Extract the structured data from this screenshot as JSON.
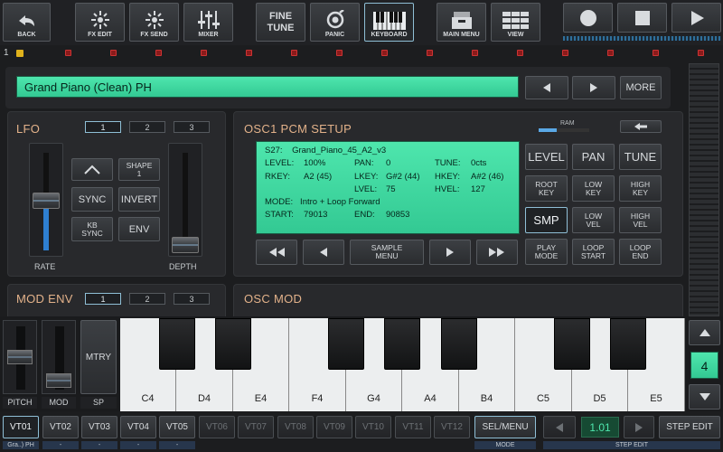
{
  "toolbar": {
    "back": "BACK",
    "fx_edit": "FX EDIT",
    "fx_send": "FX SEND",
    "mixer": "MIXER",
    "fine_tune": [
      "FINE",
      "TUNE"
    ],
    "panic": "PANIC",
    "keyboard": "KEYBOARD",
    "main_menu": "MAIN MENU",
    "view": "VIEW"
  },
  "track_row": {
    "number": "1"
  },
  "preset": {
    "name": "Grand Piano (Clean) PH",
    "more": "MORE"
  },
  "lfo": {
    "title": "LFO",
    "tabs": [
      "1",
      "2",
      "3"
    ],
    "shape_label": [
      "SHAPE",
      "1"
    ],
    "sync": "SYNC",
    "invert": "INVERT",
    "kb_sync": [
      "KB",
      "SYNC"
    ],
    "env": "ENV",
    "rate": "RATE",
    "depth": "DEPTH"
  },
  "mod_env": {
    "title": "MOD ENV",
    "tabs": [
      "1",
      "2",
      "3"
    ]
  },
  "osc1": {
    "title": "OSC1 PCM SETUP",
    "ram_label": "RAM",
    "lcd": {
      "sample": "S27:    Grand_Piano_45_A2_v3",
      "level_l": "LEVEL:",
      "level_v": "100%",
      "pan_l": "PAN:",
      "pan_v": "0",
      "tune_l": "TUNE:",
      "tune_v": "0cts",
      "rkey_l": "RKEY:",
      "rkey_v": "A2 (45)",
      "lkey_l": "LKEY:",
      "lkey_v": "G#2 (44)",
      "hkey_l": "HKEY:",
      "hkey_v": "A#2 (46)",
      "lvel_l": "LVEL:",
      "lvel_v": "75",
      "hvel_l": "HVEL:",
      "hvel_v": "127",
      "mode": "MODE:   Intro + Loop Forward",
      "start_l": "START:",
      "start_v": "79013",
      "end_l": "END:",
      "end_v": "90853"
    },
    "sample_menu": [
      "SAMPLE",
      "MENU"
    ],
    "buttons": {
      "level": "LEVEL",
      "pan": "PAN",
      "tune": "TUNE",
      "root_key": [
        "ROOT",
        "KEY"
      ],
      "low_key": [
        "LOW",
        "KEY"
      ],
      "high_key": [
        "HIGH",
        "KEY"
      ],
      "smp": "SMP",
      "low_vel": [
        "LOW",
        "VEL"
      ],
      "high_vel": [
        "HIGH",
        "VEL"
      ],
      "play_mode": [
        "PLAY",
        "MODE"
      ],
      "loop_start": [
        "LOOP",
        "START"
      ],
      "loop_end": [
        "LOOP",
        "END"
      ]
    }
  },
  "osc_mod": {
    "title": "OSC MOD"
  },
  "keyboard_panel": {
    "pitch": "PITCH",
    "mod": "MOD",
    "mtry": "MTRY",
    "sp": "SP",
    "octave": "4",
    "keys": [
      "C4",
      "D4",
      "E4",
      "F4",
      "G4",
      "A4",
      "B4",
      "C5",
      "D5",
      "E5"
    ]
  },
  "voice_tracks": [
    "VT01",
    "VT02",
    "VT03",
    "VT04",
    "VT05",
    "VT06",
    "VT07",
    "VT08",
    "VT09",
    "VT10",
    "VT11",
    "VT12"
  ],
  "voice_track_labels": [
    "Gra..) PH",
    "-",
    "-",
    "-",
    "-"
  ],
  "bottom": {
    "sel_menu": "SEL/MENU",
    "mode": "MODE",
    "step_value": "1.01",
    "step_edit": "STEP EDIT",
    "step_edit_small": "STEP EDIT"
  },
  "colors": {
    "lcd": "#42dba3",
    "accent_title": "#e3b28a",
    "selected_border": "#8fbfd6"
  }
}
